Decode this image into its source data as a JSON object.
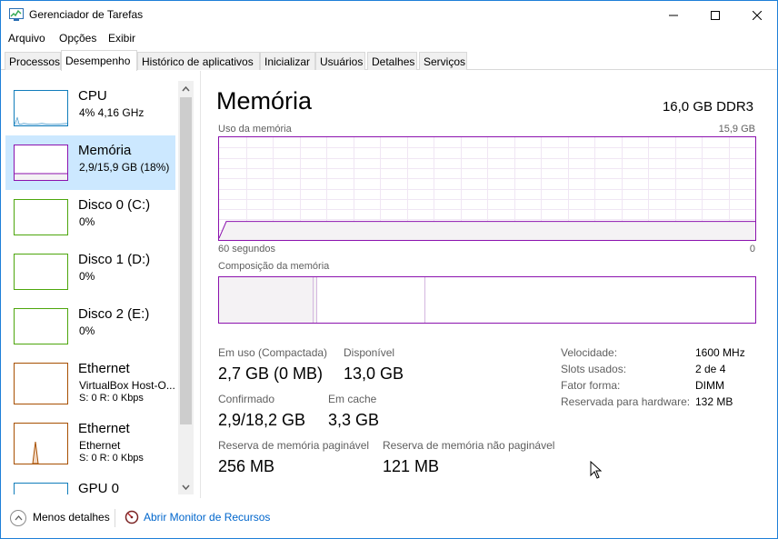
{
  "window": {
    "title": "Gerenciador de Tarefas"
  },
  "menu": [
    "Arquivo",
    "Opções",
    "Exibir"
  ],
  "tabs": [
    "Processos",
    "Desempenho",
    "Histórico de aplicativos",
    "Inicializar",
    "Usuários",
    "Detalhes",
    "Serviços"
  ],
  "active_tab": "Desempenho",
  "sidebar": {
    "items": [
      {
        "title": "CPU",
        "sub": "4% 4,16 GHz",
        "sub2": "",
        "color": "#117dbb"
      },
      {
        "title": "Memória",
        "sub": "2,9/15,9 GB (18%)",
        "sub2": "",
        "color": "#8b12ae"
      },
      {
        "title": "Disco 0 (C:)",
        "sub": "0%",
        "sub2": "",
        "color": "#4da60c"
      },
      {
        "title": "Disco 1 (D:)",
        "sub": "0%",
        "sub2": "",
        "color": "#4da60c"
      },
      {
        "title": "Disco 2 (E:)",
        "sub": "0%",
        "sub2": "",
        "color": "#4da60c"
      },
      {
        "title": "Ethernet",
        "sub": "VirtualBox Host-O...",
        "sub2": "S: 0 R: 0 Kbps",
        "color": "#a74f01"
      },
      {
        "title": "Ethernet",
        "sub": "Ethernet",
        "sub2": "S: 0 R: 0 Kbps",
        "color": "#a74f01"
      },
      {
        "title": "GPU 0",
        "sub": "",
        "sub2": "",
        "color": "#117dbb"
      }
    ]
  },
  "main": {
    "title": "Memória",
    "spec": "16,0 GB DDR3",
    "usage_label": "Uso da memória",
    "usage_max": "15,9 GB",
    "time_left": "60 segundos",
    "time_right": "0",
    "composition_label": "Composição da memória",
    "stats": {
      "in_use_label": "Em uso (Compactada)",
      "in_use_value": "2,7 GB (0 MB)",
      "available_label": "Disponível",
      "available_value": "13,0 GB",
      "committed_label": "Confirmado",
      "committed_value": "2,9/18,2 GB",
      "cached_label": "Em cache",
      "cached_value": "3,3 GB",
      "paged_label": "Reserva de memória paginável",
      "paged_value": "256 MB",
      "nonpaged_label": "Reserva de memória não paginável",
      "nonpaged_value": "121 MB"
    },
    "details": [
      {
        "label": "Velocidade:",
        "value": "1600 MHz"
      },
      {
        "label": "Slots usados:",
        "value": "2 de 4"
      },
      {
        "label": "Fator forma:",
        "value": "DIMM"
      },
      {
        "label": "Reservada para hardware:",
        "value": "132 MB"
      }
    ],
    "usage_percent": 18
  },
  "footer": {
    "less_details": "Menos detalhes",
    "resource_monitor": "Abrir Monitor de Recursos"
  },
  "colors": {
    "accent_memory": "#8b12ae",
    "selection": "#cce8ff",
    "link": "#0066cc"
  }
}
